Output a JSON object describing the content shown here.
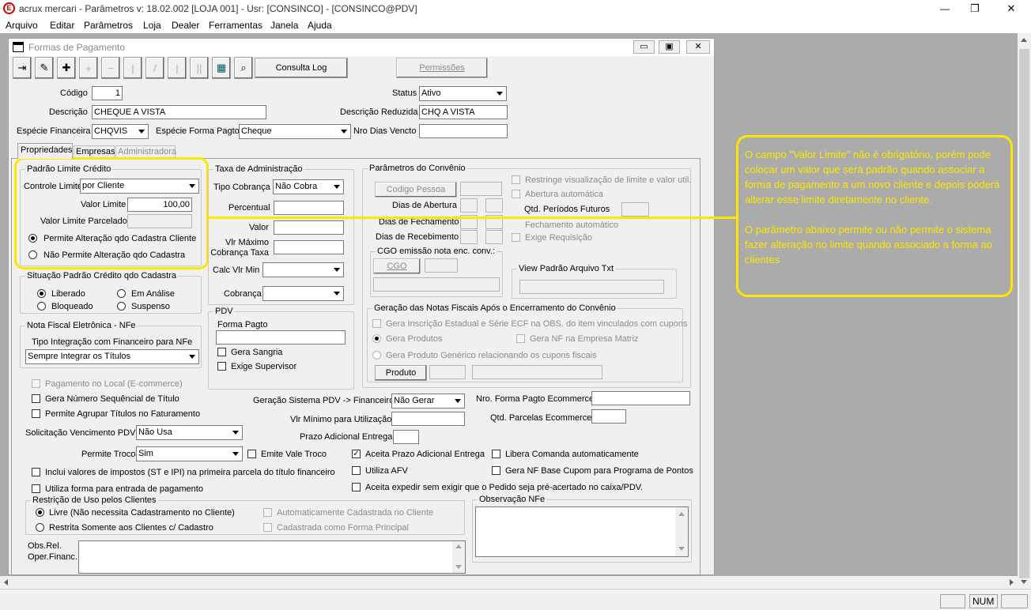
{
  "app": {
    "logo": "E",
    "title": "acrux mercari - Parâmetros  v: 18.02.002  [LOJA 001] - Usr: [CONSINCO] - [CONSINCO@PDV]"
  },
  "window_controls": {
    "minimize": "—",
    "restore": "❐",
    "close": "✕"
  },
  "menu": [
    "Arquivo",
    "Editar",
    "Parâmetros",
    "Loja",
    "Dealer",
    "Ferramentas",
    "Janela",
    "Ajuda"
  ],
  "child_window": {
    "title": "Formas de Pagamento"
  },
  "toolbar": {
    "consulta_log": "Consulta Log",
    "permissoes": "Permissões"
  },
  "header": {
    "codigo_label": "Código",
    "codigo_value": "1",
    "status_label": "Status",
    "status_value": "Ativo",
    "descricao_label": "Descrição",
    "descricao_value": "CHEQUE A VISTA",
    "descricao_reduzida_label": "Descrição Reduzida",
    "descricao_reduzida_value": "CHQ A VISTA",
    "especie_financeira_label": "Espécie Financeira",
    "especie_financeira_value": "CHQVIS",
    "especie_forma_pagto_label": "Espécie Forma Pagto",
    "especie_forma_pagto_value": "Cheque",
    "nro_dias_vencto_label": "Nro Dias Vencto"
  },
  "tabs": [
    "Propriedades",
    "Empresas",
    "Administradora"
  ],
  "padrao_limite": {
    "title": "Padrão Limite Crédito",
    "controle_label": "Controle Limite",
    "controle_value": "por Cliente",
    "valor_limite_label": "Valor Limite",
    "valor_limite_value": "100,00",
    "valor_parcelado_label": "Valor Limite Parcelado",
    "opt1": "Permite Alteração qdo Cadastra Cliente",
    "opt2": "Não Permite Alteração qdo Cadastra"
  },
  "situacao": {
    "title": "Situação Padrão Crédito qdo Cadastra",
    "liberado": "Liberado",
    "em_analise": "Em Análise",
    "bloqueado": "Bloqueado",
    "suspenso": "Suspenso"
  },
  "nfe": {
    "title": "Nota Fiscal Eletrônica - NFe",
    "tipo_label": "Tipo Integração com Financeiro para NFe",
    "tipo_value": "Sempre Integrar os Títulos"
  },
  "taxa": {
    "title": "Taxa de Administração",
    "tipo_cobranca_label": "Tipo Cobrança",
    "tipo_cobranca_value": "Não Cobra",
    "percentual_label": "Percentual",
    "valor_label": "Valor",
    "vlr_maximo_label1": "Vlr Máximo",
    "vlr_maximo_label2": "Cobrança Taxa",
    "calc_vlr_min_label": "Calc Vlr Min",
    "cobranca_label": "Cobrança"
  },
  "pdv": {
    "title": "PDV",
    "forma_pagto_label": "Forma Pagto",
    "gera_sangria": "Gera Sangria",
    "exige_supervisor": "Exige Supervisor"
  },
  "convenio": {
    "title": "Parâmetros do Convênio",
    "codigo_pessoa": "Codigo Pessoa",
    "dias_abertura": "Dias de Abertura",
    "dias_fechamento": "Dias de Fechamento",
    "dias_recebimento": "Dias de Recebimento",
    "restringe": "Restringe visualização de limite e valor util.",
    "abertura_auto": "Abertura automática",
    "qtd_periodos": "Qtd. Períodos Futuros",
    "fechamento_auto": "Fechamento automático",
    "exige_requisicao": "Exige Requisição"
  },
  "cgo": {
    "title": "CGO emissão nota enc. conv.:",
    "button": "CGO"
  },
  "view_padrao": {
    "title": "View Padrão Arquivo Txt"
  },
  "geracao_nf": {
    "title": "Geração das Notas Fiscais Após o Encerramento do Convênio",
    "opt1": "Gera Inscrição Estadual e Série ECF na OBS. do item vinculados com cupons",
    "opt2": "Gera Produtos",
    "opt3": "Gera NF na Empresa Matriz",
    "opt4": "Gera Produto Genérico relacionando os cupons fiscais",
    "produto_btn": "Produto"
  },
  "annotation": {
    "p1": "O campo \"Valor Limite\" não é obrigatório, porém pode colocar um valor que será padrão quando associar a forma de pagamento a um novo cliente e depois poderá alterar esse limite diretamente no cliente.",
    "p2": "O parâmetro abaixo permite ou não permite o sistema fazer alteração no limite quando associado a forma ao clientes"
  },
  "lower": {
    "pagamento_local": "Pagamento no Local (E-commerce)",
    "gera_numero_seq": "Gera Número Sequêncial de Título",
    "permite_agrupar": "Permite Agrupar Títulos no Faturamento",
    "solic_venc_label": "Solicitação Vencimento PDV",
    "solic_venc_value": "Não Usa",
    "permite_troco_label": "Permite Troco",
    "permite_troco_value": "Sim",
    "emite_vale_troco": "Emite Vale Troco",
    "inclui_impostos": "Inclui valores de impostos (ST e IPI) na primeira parcela do título financeiro",
    "utiliza_forma": "Utiliza forma para entrada de pagamento",
    "geracao_pdv_label": "Geração Sistema PDV -> Financeiro",
    "geracao_pdv_value": "Não Gerar",
    "vlr_minimo_label": "Vlr Mínimo para Utilização",
    "prazo_adicional_label": "Prazo Adicional Entrega",
    "nro_forma_ecom_label": "Nro. Forma Pagto Ecommerce",
    "qtd_parcelas_ecom_label": "Qtd. Parcelas Ecommerce",
    "aceita_prazo": "Aceita Prazo Adicional Entrega",
    "libera_comanda": "Libera Comanda automaticamente",
    "utiliza_afv": "Utiliza AFV",
    "gera_nf_base": "Gera NF Base Cupom para Programa de Pontos",
    "aceita_expedir": "Aceita expedir sem exigir que o Pedido seja pré-acertado no caixa/PDV."
  },
  "restricao": {
    "title": "Restrição de Uso pelos Clientes",
    "livre": "Livre (Não necessita Cadastramento no Cliente)",
    "restrita": "Restrita Somente aos Clientes c/ Cadastro",
    "auto_cadastrada": "Automaticamente Cadastrada no Cliente",
    "cadastrada_principal": "Cadastrada como Forma Principal"
  },
  "obs_nfe": {
    "title": "Observação NFe"
  },
  "obs_rel": {
    "label1": "Obs.Rel.",
    "label2": "Oper.Financ."
  },
  "statusbar": {
    "num": "NUM"
  },
  "colors": {
    "annotation": "#ffe600",
    "annotation_text": "#f0c000"
  }
}
